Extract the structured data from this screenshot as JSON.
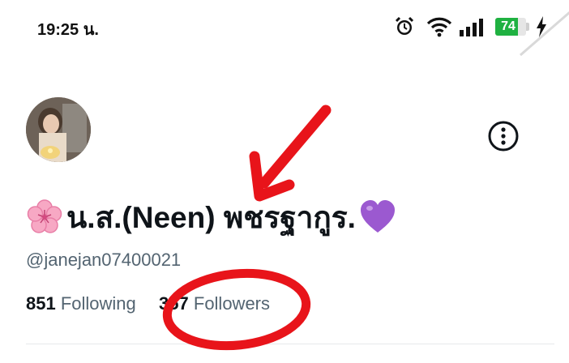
{
  "status_bar": {
    "time": "19:25 น.",
    "battery_level": 74,
    "battery_text": "74",
    "icons": [
      "alarm-icon",
      "wifi-icon",
      "signal-icon",
      "battery-icon",
      "charging-icon"
    ]
  },
  "profile": {
    "display_name": "น.ส.(Neen) พชรฐากูร.",
    "name_prefix_emoji": "cherry-blossom",
    "name_suffix_emoji": "purple-heart",
    "handle": "@janejan07400021",
    "following_count": "851",
    "following_label": "Following",
    "followers_count": "357",
    "followers_label": "Followers"
  },
  "colors": {
    "accent_annotation": "#e8141a",
    "battery_green": "#1fb141",
    "secondary_text": "#536471",
    "primary_text": "#0f1419"
  }
}
